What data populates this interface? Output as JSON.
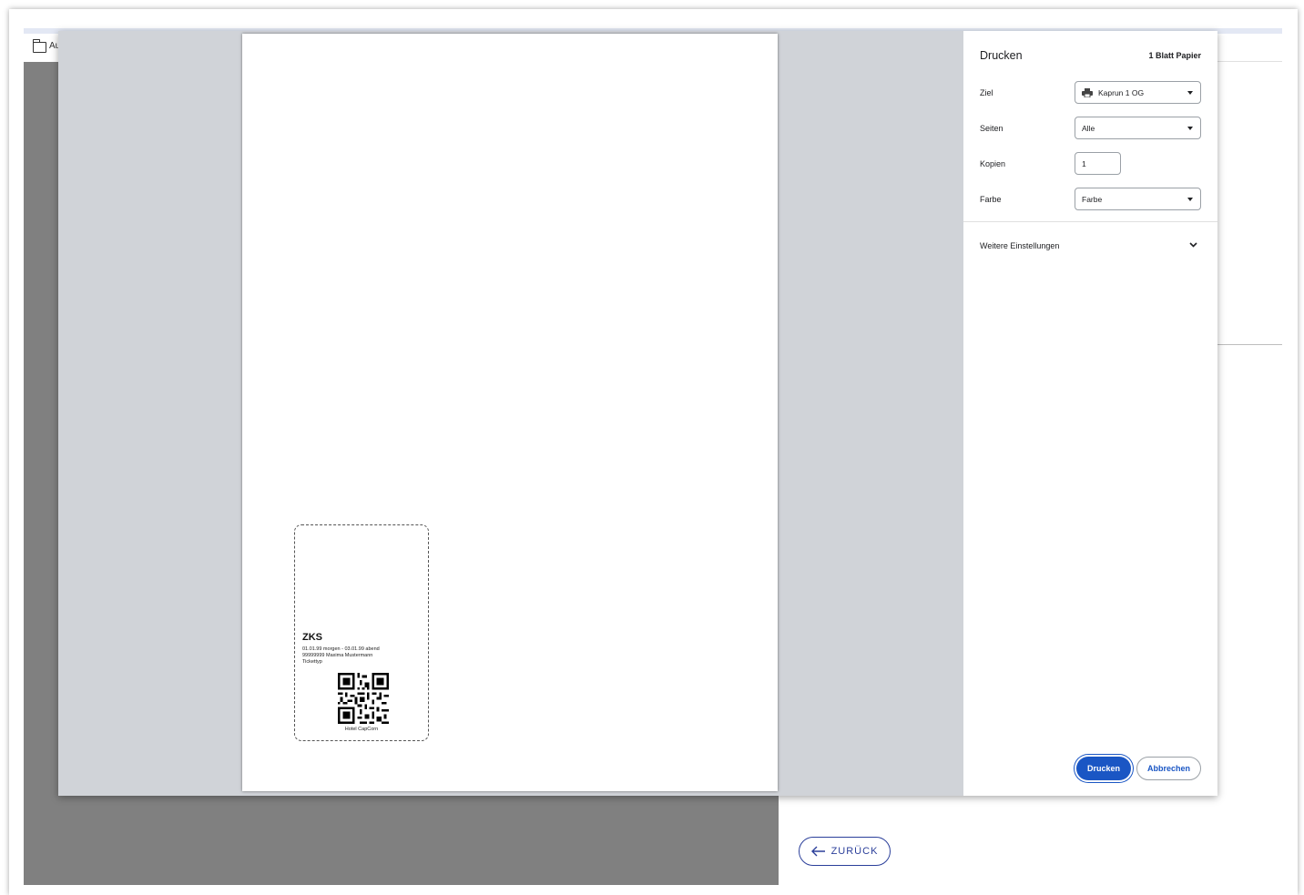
{
  "background": {
    "tab_label": "Au",
    "back_button_label": "ZURÜCK"
  },
  "preview": {
    "ticket": {
      "title": "ZKS",
      "line1": "01.01.99 morgen - 03.01.99 abend",
      "line2": "99999999 Maxima Mustermann",
      "line3": "Tickettyp",
      "footer": "Hotel CapCorn"
    }
  },
  "print_panel": {
    "title": "Drucken",
    "sheet_count": "1 Blatt Papier",
    "destination_label": "Ziel",
    "destination_value": "Kaprun 1 OG",
    "pages_label": "Seiten",
    "pages_value": "Alle",
    "copies_label": "Kopien",
    "copies_value": "1",
    "color_label": "Farbe",
    "color_value": "Farbe",
    "more_settings_label": "Weitere Einstellungen",
    "print_button": "Drucken",
    "cancel_button": "Abbrechen"
  },
  "colors": {
    "primary": "#1a56c4",
    "back_button": "#2b3f9a",
    "dialog_bg": "#d0d3d8",
    "page_gray": "#808080"
  }
}
